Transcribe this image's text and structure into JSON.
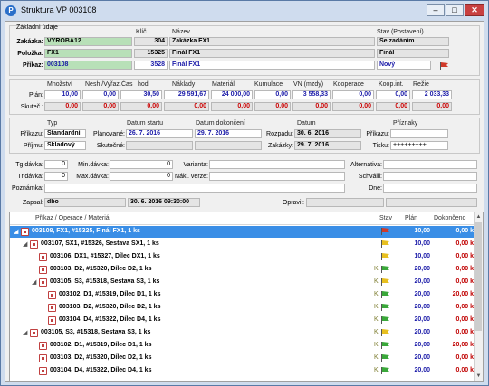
{
  "window": {
    "title": "Struktura VP 003108",
    "icon": "app-icon",
    "min": "–",
    "max": "□",
    "close": "✕"
  },
  "basic": {
    "section": "Základní údaje",
    "col_klic": "Klíč",
    "col_nazev": "Název",
    "col_stav": "Stav (Postavení)",
    "rows": [
      {
        "label": "Zakázka:",
        "value": "VYROBA12",
        "klic": "304",
        "nazev": "Zakázka FX1",
        "stav": "Se zadáním"
      },
      {
        "label": "Položka:",
        "value": "FX1",
        "klic": "15325",
        "nazev": "Finál FX1",
        "stav": "Finál"
      },
      {
        "label": "Příkaz:",
        "value": "003108",
        "klic": "3528",
        "nazev": "Finál FX1",
        "stav": "Nový"
      }
    ]
  },
  "quantities": {
    "headers": [
      "Množství",
      "Nesh./Vyřaz.",
      "Čas",
      "hod.",
      "Náklady",
      "Materiál",
      "Kumulace",
      "VN (mzdy)",
      "Kooperace",
      "Koop.int.",
      "Režie"
    ],
    "plan_label": "Plán:",
    "plan": [
      "10,00",
      "0,00",
      "30,50",
      "29 591,67",
      "24 000,00",
      "0,00",
      "3 558,33",
      "0,00",
      "0,00",
      "2 033,33"
    ],
    "actual_label": "Skuteč.:",
    "actual": [
      "0,00",
      "0,00",
      "0,00",
      "0,00",
      "0,00",
      "0,00",
      "0,00",
      "0,00",
      "0,00",
      "0,00"
    ]
  },
  "dates": {
    "typ_header": "Typ",
    "start_header": "Datum startu",
    "end_header": "Datum dokončení",
    "datum_header": "Datum",
    "priznaky_header": "Příznaky",
    "prikaz_label": "Příkazu:",
    "prikaz_typ": "Standardní",
    "prijmu_label": "Příjmu:",
    "prijmu_typ": "Skladový",
    "planovane_label": "Plánované:",
    "planovane_start": "26. 7. 2016",
    "planovane_end": "29. 7. 2016",
    "skutecne_label": "Skutečné:",
    "skutecne_start": "",
    "skutecne_end": "",
    "rozpadu_label": "Rozpadu:",
    "rozpadu": "30. 6. 2016",
    "zakazky_label": "Zakázky:",
    "zakazky": "29. 7. 2016",
    "priznaky_prikazu_label": "Příkazu:",
    "priznaky_prikazu": "",
    "tisku_label": "Tisku:",
    "tisku": "+++++++++"
  },
  "misc": {
    "tg_label": "Tg.dávka:",
    "tg": "0",
    "min_label": "Min.dávka:",
    "min": "0",
    "varianta_label": "Varianta:",
    "varianta": "",
    "alternativa_label": "Alternativa:",
    "alternativa": "",
    "tr_label": "Tr.dávka:",
    "tr": "0",
    "max_label": "Max.dávka:",
    "max": "0",
    "nakl_label": "Nákl. verze:",
    "nakl": "",
    "schvalil_label": "Schválil:",
    "schvalil": "",
    "poznamka_label": "Poznámka:",
    "poznamka": "",
    "dne_label": "Dne:",
    "dne": "",
    "zapsal_label": "Zapsal:",
    "zapsal": "dbo",
    "zapsal_dt": "30. 6. 2016 09:30:00",
    "opravil_label": "Opravil:",
    "opravil": "",
    "opravil_dt": ""
  },
  "tree": {
    "headers": {
      "name": "Příkaz / Operace / Materiál",
      "stav": "Stav",
      "plan": "Plán",
      "done": "Dokončeno"
    },
    "rows": [
      {
        "text": "003108, FX1, #15325, Finál FX1, 1 ks",
        "k": "",
        "flag": "red",
        "plan": "10,00",
        "done": "0,00 k",
        "done_color": "#ffffff",
        "sel": true,
        "lvl": 0,
        "exp": "◢"
      },
      {
        "text": "003107, SX1, #15326, Sestava SX1, 1 ks",
        "k": "",
        "flag": "yellow",
        "plan": "10,00",
        "done": "0,00 k",
        "done_color": "#c00000",
        "sel": false,
        "lvl": 1,
        "exp": "◢"
      },
      {
        "text": "003106, DX1, #15327, Dílec DX1, 1 ks",
        "k": "",
        "flag": "yellow",
        "plan": "10,00",
        "done": "0,00 k",
        "done_color": "#c00000",
        "sel": false,
        "lvl": 2,
        "exp": ""
      },
      {
        "text": "003103, D2, #15320, Dílec D2, 1 ks",
        "k": "K",
        "flag": "green",
        "plan": "20,00",
        "done": "0,00 k",
        "done_color": "#c00000",
        "sel": false,
        "lvl": 2,
        "exp": ""
      },
      {
        "text": "003105, S3, #15318, Sestava S3, 1 ks",
        "k": "K",
        "flag": "yellow",
        "plan": "20,00",
        "done": "0,00 k",
        "done_color": "#c00000",
        "sel": false,
        "lvl": 2,
        "exp": "◢"
      },
      {
        "text": "003102, D1, #15319, Dílec D1, 1 ks",
        "k": "K",
        "flag": "green",
        "plan": "20,00",
        "done": "20,00 k",
        "done_color": "#c00000",
        "sel": false,
        "lvl": 3,
        "exp": ""
      },
      {
        "text": "003103, D2, #15320, Dílec D2, 1 ks",
        "k": "K",
        "flag": "green",
        "plan": "20,00",
        "done": "0,00 k",
        "done_color": "#c00000",
        "sel": false,
        "lvl": 3,
        "exp": ""
      },
      {
        "text": "003104, D4, #15322, Dílec D4, 1 ks",
        "k": "K",
        "flag": "green",
        "plan": "20,00",
        "done": "0,00 k",
        "done_color": "#c00000",
        "sel": false,
        "lvl": 3,
        "exp": ""
      },
      {
        "text": "003105, S3, #15318, Sestava S3, 1 ks",
        "k": "K",
        "flag": "yellow",
        "plan": "20,00",
        "done": "0,00 k",
        "done_color": "#c00000",
        "sel": false,
        "lvl": 1,
        "exp": "◢"
      },
      {
        "text": "003102, D1, #15319, Dílec D1, 1 ks",
        "k": "K",
        "flag": "green",
        "plan": "20,00",
        "done": "20,00 k",
        "done_color": "#c00000",
        "sel": false,
        "lvl": 2,
        "exp": ""
      },
      {
        "text": "003103, D2, #15320, Dílec D2, 1 ks",
        "k": "K",
        "flag": "green",
        "plan": "20,00",
        "done": "0,00 k",
        "done_color": "#c00000",
        "sel": false,
        "lvl": 2,
        "exp": ""
      },
      {
        "text": "003104, D4, #15322, Dílec D4, 1 ks",
        "k": "K",
        "flag": "green",
        "plan": "20,00",
        "done": "0,00 k",
        "done_color": "#c00000",
        "sel": false,
        "lvl": 2,
        "exp": ""
      }
    ]
  },
  "colors": {
    "red_flag": "#d03a2a",
    "yellow_flag": "#e8c020",
    "green_flag": "#3aa83a",
    "selection": "#3a8ee6",
    "green_field": "#b8e0b8"
  }
}
